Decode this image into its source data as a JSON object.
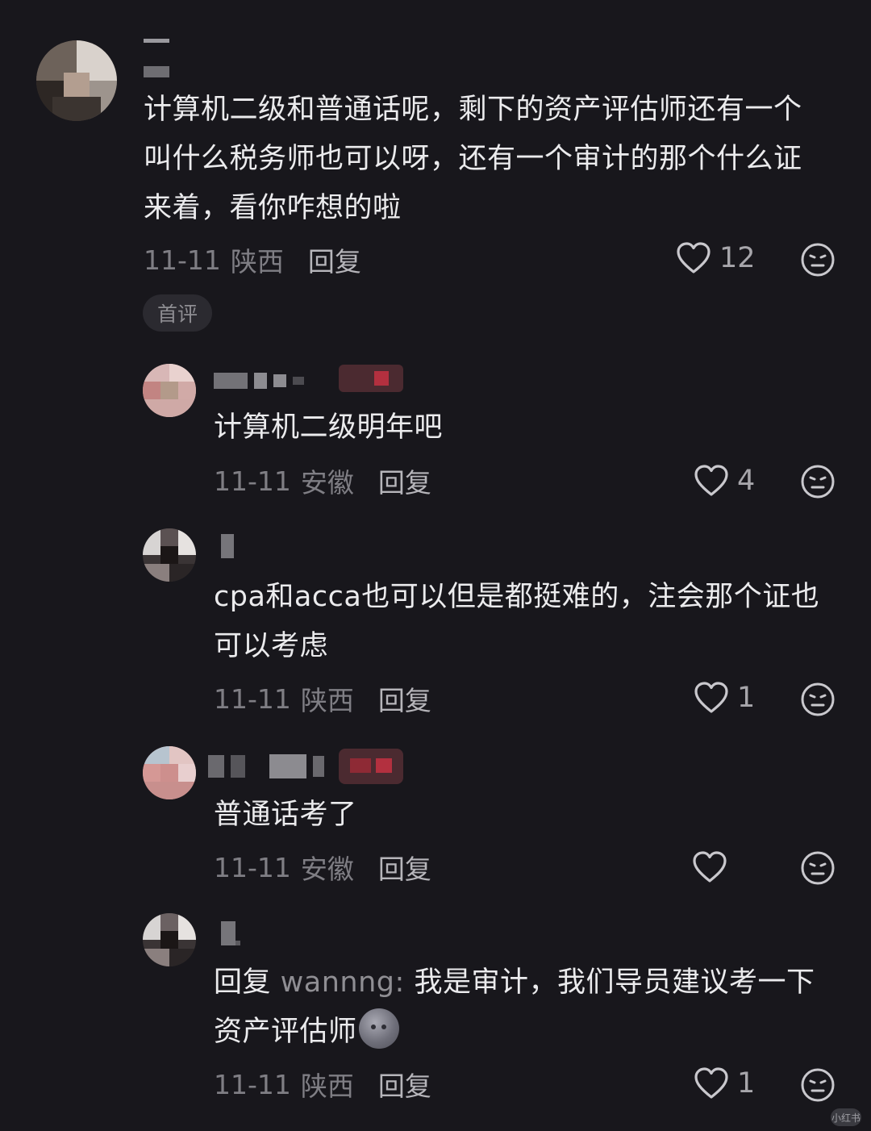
{
  "comments": [
    {
      "text": "计算机二级和普通话呢，剩下的资产评估师还有一个叫什么税务师也可以呀，还有一个审计的那个什么证来着，看你咋想的啦",
      "date": "11-11",
      "location": "陕西",
      "reply_label": "回复",
      "likes": "12",
      "tag": "首评"
    }
  ],
  "replies": [
    {
      "text": "计算机二级明年吧",
      "date": "11-11",
      "location": "安徽",
      "reply_label": "回复",
      "likes": "4"
    },
    {
      "text": "cpa和acca也可以但是都挺难的，注会那个证也可以考虑",
      "date": "11-11",
      "location": "陕西",
      "reply_label": "回复",
      "likes": "1"
    },
    {
      "text": "普通话考了",
      "date": "11-11",
      "location": "安徽",
      "reply_label": "回复",
      "likes": ""
    },
    {
      "reply_prefix": "回复",
      "mention": "wannng:",
      "text": "我是审计，我们导员建议考一下资产评估师",
      "emoji": "moon-face",
      "date": "11-11",
      "location": "陕西",
      "reply_label": "回复",
      "likes": "1"
    }
  ],
  "watermark": "小红书",
  "icons": {
    "like": "heart-icon",
    "dislike": "neutral-face-icon"
  }
}
